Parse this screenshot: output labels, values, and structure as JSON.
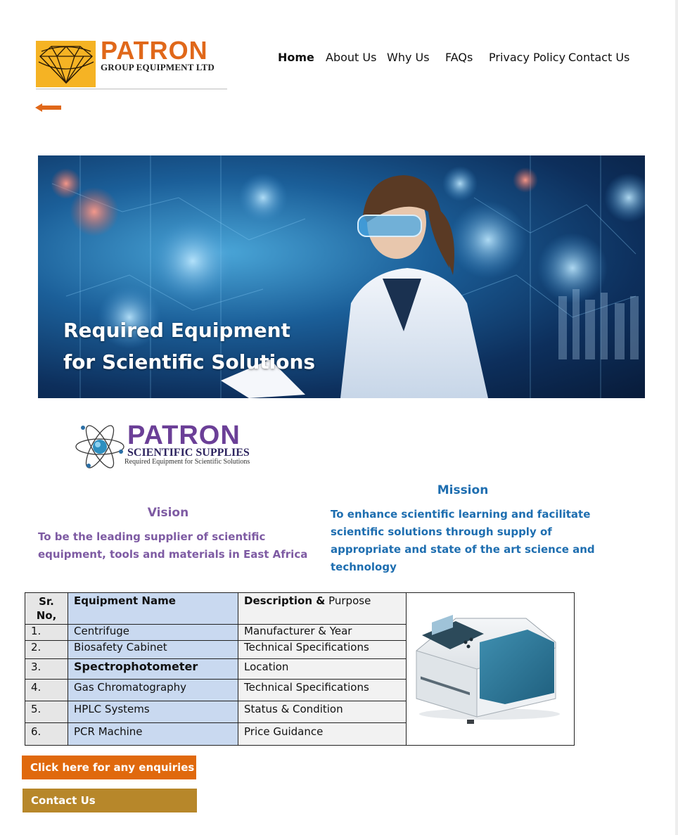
{
  "header": {
    "logo_title": "PATRON",
    "logo_subtitle": "GROUP EQUIPMENT LTD",
    "nav": [
      {
        "label": "Home",
        "active": true
      },
      {
        "label": "About Us"
      },
      {
        "label": "Why Us"
      },
      {
        "label": "FAQs"
      },
      {
        "label": "Privacy Policy"
      },
      {
        "label": "Contact Us"
      }
    ],
    "back_icon": "back-arrow-icon",
    "accent_color": "#e0681a",
    "logo_box_color": "#f5b324"
  },
  "hero": {
    "title": "Required Equipment for Scientific Solutions"
  },
  "brand": {
    "title": "PATRON",
    "subtitle": "SCIENTIFIC SUPPLIES",
    "tagline": "Required Equipment for Scientific Solutions",
    "color": "#6b3f97"
  },
  "vision": {
    "heading": "Vision",
    "text": "To be the leading supplier of scientific equipment, tools and materials in East Africa",
    "color": "#7e5ba3"
  },
  "mission": {
    "heading": "Mission",
    "text": "To enhance scientific learning and facilitate scientific solutions through supply of appropriate and state of the art science and technology",
    "color": "#1e6eb0"
  },
  "table": {
    "headers": {
      "sr": "Sr. No,",
      "name": "Equipment Name",
      "desc_bold": "Description &",
      "desc_rest": " Purpose"
    },
    "rows": [
      {
        "sr": "1.",
        "name": "Centrifuge",
        "desc": "Manufacturer & Year"
      },
      {
        "sr": "2.",
        "name": "Biosafety Cabinet",
        "desc": "Technical Specifications"
      },
      {
        "sr": "3.",
        "name": "Spectrophotometer",
        "desc": "Location"
      },
      {
        "sr": "4.",
        "name": "Gas Chromatography",
        "desc": "Technical Specifications"
      },
      {
        "sr": "5.",
        "name": "HPLC Systems",
        "desc": "Status & Condition"
      },
      {
        "sr": "6.",
        "name": "PCR Machine",
        "desc": "Price Guidance"
      }
    ]
  },
  "buttons": {
    "enquiry": "Click here for any enquiries",
    "contact": "Contact Us",
    "enquiry_color": "#e0690d",
    "contact_color": "#b7872a"
  }
}
